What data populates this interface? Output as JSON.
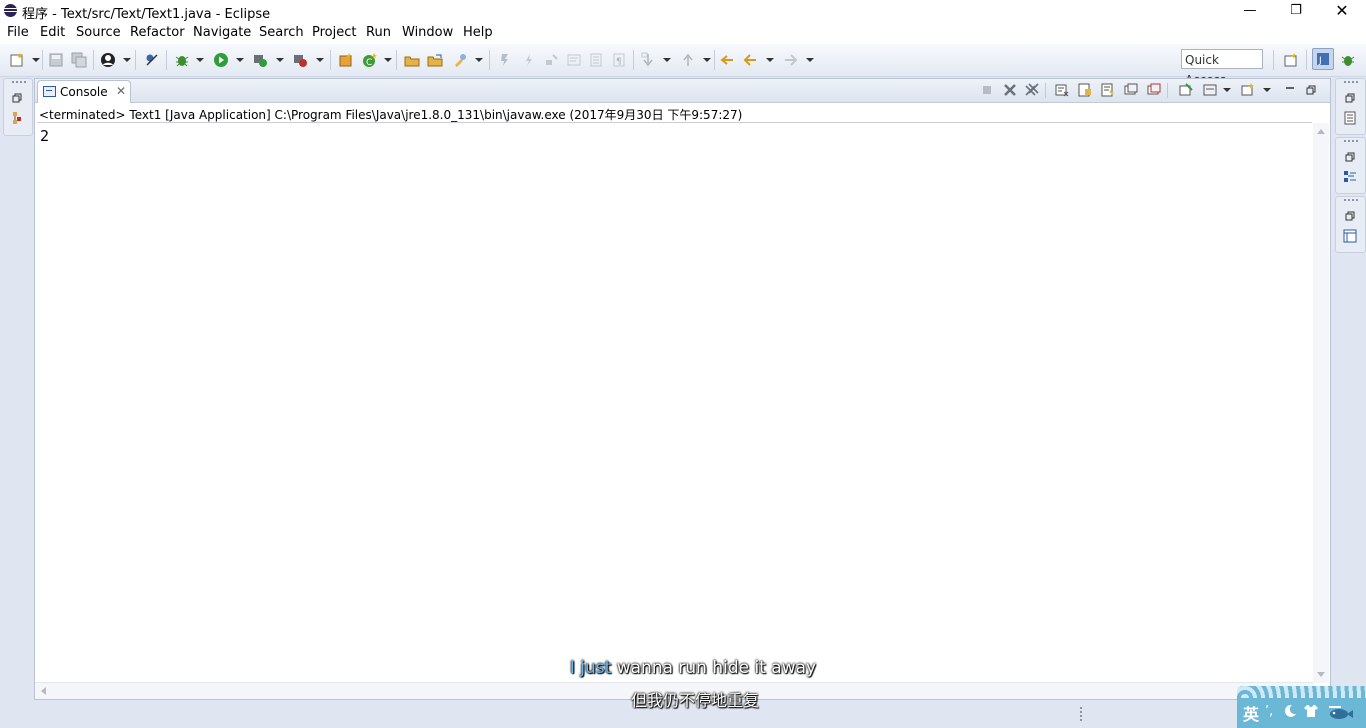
{
  "window": {
    "title": "程序 - Text/src/Text/Text1.java - Eclipse",
    "controls": {
      "minimize": "—",
      "maximize": "❐",
      "close": "✕"
    }
  },
  "menu": [
    "File",
    "Edit",
    "Source",
    "Refactor",
    "Navigate",
    "Search",
    "Project",
    "Run",
    "Window",
    "Help"
  ],
  "toolbar": {
    "quick_access_placeholder": "Quick Access"
  },
  "console_view": {
    "tab_label": "Console",
    "tab_close": "✕",
    "process_label": "<terminated> Text1 [Java Application] C:\\Program Files\\Java\\jre1.8.0_131\\bin\\javaw.exe (2017年9月30日 下午9:57:27)",
    "output": "2"
  },
  "subtitles": {
    "english_highlight": "I just",
    "english_rest": " wanna run hide it away",
    "chinese": "但我仍不停地重复"
  },
  "ime": {
    "lang": "英",
    "icons": [
      "moon-icon",
      "shirt-icon",
      "fish-icon"
    ]
  },
  "colors": {
    "run_green": "#2e9e3a",
    "debug_green": "#3c8d2f",
    "accent_blue": "#2b5aa0",
    "ime_blue": "#6bb7d6"
  }
}
